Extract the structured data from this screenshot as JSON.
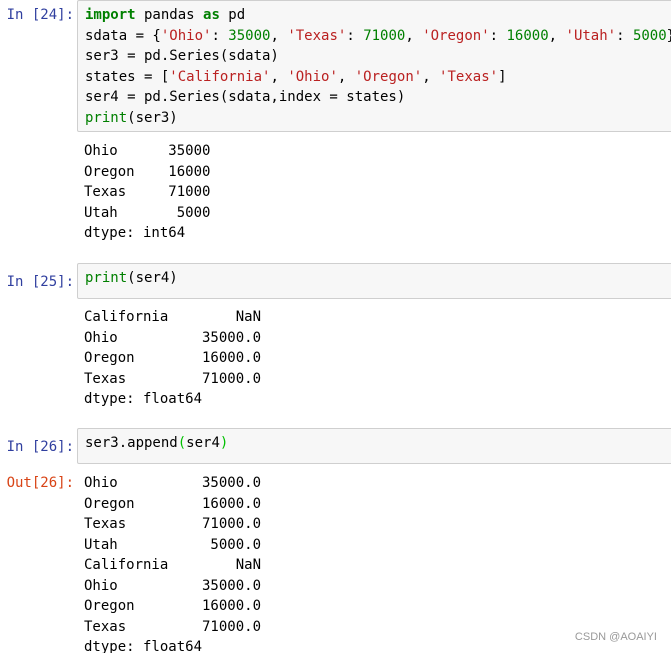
{
  "cells": [
    {
      "prompt": "In [24]:",
      "code": [
        [
          {
            "t": "import",
            "c": "kw"
          },
          {
            "t": " pandas "
          },
          {
            "t": "as",
            "c": "kw"
          },
          {
            "t": " pd"
          }
        ],
        [
          {
            "t": "sdata = {"
          },
          {
            "t": "'Ohio'",
            "c": "str"
          },
          {
            "t": ": "
          },
          {
            "t": "35000",
            "c": "num"
          },
          {
            "t": ", "
          },
          {
            "t": "'Texas'",
            "c": "str"
          },
          {
            "t": ": "
          },
          {
            "t": "71000",
            "c": "num"
          },
          {
            "t": ", "
          },
          {
            "t": "'Oregon'",
            "c": "str"
          },
          {
            "t": ": "
          },
          {
            "t": "16000",
            "c": "num"
          },
          {
            "t": ", "
          },
          {
            "t": "'Utah'",
            "c": "str"
          },
          {
            "t": ": "
          },
          {
            "t": "5000",
            "c": "num"
          },
          {
            "t": "}"
          }
        ],
        [
          {
            "t": "ser3 = pd.Series(sdata)"
          }
        ],
        [
          {
            "t": "states = ["
          },
          {
            "t": "'California'",
            "c": "str"
          },
          {
            "t": ", "
          },
          {
            "t": "'Ohio'",
            "c": "str"
          },
          {
            "t": ", "
          },
          {
            "t": "'Oregon'",
            "c": "str"
          },
          {
            "t": ", "
          },
          {
            "t": "'Texas'",
            "c": "str"
          },
          {
            "t": "]"
          }
        ],
        [
          {
            "t": "ser4 = pd.Series(sdata,index = states)"
          }
        ],
        [
          {
            "t": "print",
            "c": "bi"
          },
          {
            "t": "(ser3)"
          }
        ]
      ],
      "output": [
        "Ohio      35000",
        "Oregon    16000",
        "Texas     71000",
        "Utah       5000",
        "dtype: int64"
      ]
    },
    {
      "prompt": "In [25]:",
      "code": [
        [
          {
            "t": "print",
            "c": "bi"
          },
          {
            "t": "(ser4)"
          }
        ]
      ],
      "output": [
        "California        NaN",
        "Ohio          35000.0",
        "Oregon        16000.0",
        "Texas         71000.0",
        "dtype: float64"
      ]
    },
    {
      "prompt": "In [26]:",
      "code": [
        [
          {
            "t": "ser3.append"
          },
          {
            "t": "(",
            "c": "bracket-match"
          },
          {
            "t": "ser4"
          },
          {
            "t": ")",
            "c": "bracket-match"
          }
        ]
      ],
      "out_prompt": "Out[26]:",
      "output": [
        "Ohio          35000.0",
        "Oregon        16000.0",
        "Texas         71000.0",
        "Utah           5000.0",
        "California        NaN",
        "Ohio          35000.0",
        "Oregon        16000.0",
        "Texas         71000.0",
        "dtype: float64"
      ]
    }
  ],
  "watermark": "CSDN @AOAIYI",
  "colors": {
    "in_prompt": "#303f9f",
    "out_prompt": "#d84315",
    "keyword": "#008000",
    "string": "#ba2121",
    "number": "#008000",
    "input_bg": "#f7f7f7",
    "input_border": "#cfcfcf"
  }
}
